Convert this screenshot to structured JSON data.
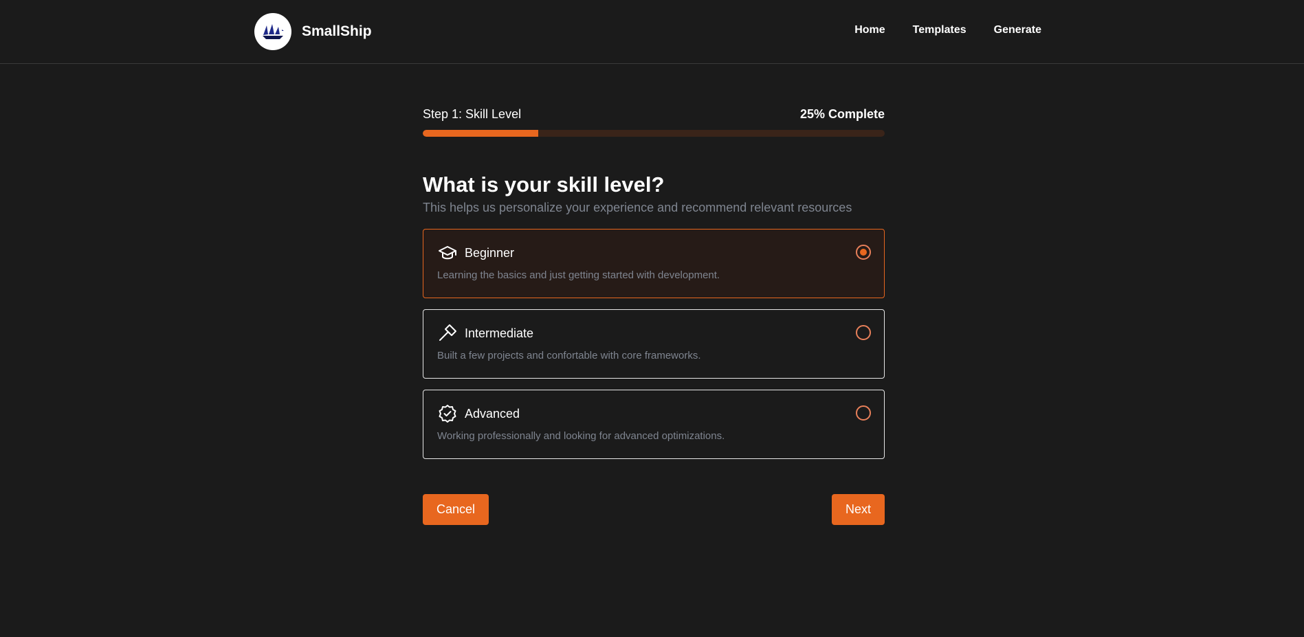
{
  "header": {
    "brand": "SmallShip",
    "nav": [
      {
        "label": "Home"
      },
      {
        "label": "Templates"
      },
      {
        "label": "Generate"
      }
    ]
  },
  "progress": {
    "step_label": "Step 1: Skill Level",
    "complete_label": "25% Complete",
    "percent": 25
  },
  "question": {
    "title": "What is your skill level?",
    "subtitle": "This helps us personalize your experience and recommend relevant resources"
  },
  "options": [
    {
      "title": "Beginner",
      "description": "Learning the basics and just getting started with development.",
      "icon": "graduation-cap-icon",
      "selected": true
    },
    {
      "title": "Intermediate",
      "description": "Built a few projects and confortable with core frameworks.",
      "icon": "hammer-icon",
      "selected": false
    },
    {
      "title": "Advanced",
      "description": "Working professionally and looking for advanced optimizations.",
      "icon": "badge-check-icon",
      "selected": false
    }
  ],
  "actions": {
    "cancel_label": "Cancel",
    "next_label": "Next"
  },
  "colors": {
    "accent": "#e8671f",
    "background": "#1b1b1b",
    "muted_text": "#7f8590",
    "progress_track": "#3a2419",
    "selected_bg": "#261b17"
  }
}
